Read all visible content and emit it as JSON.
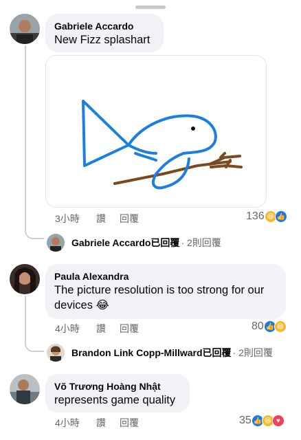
{
  "comments": [
    {
      "author": "Gabriele Accardo",
      "text": "New Fizz splashart",
      "time": "3小時",
      "like_label": "讚",
      "reply_label": "回覆",
      "reaction_count": "136",
      "reactions": [
        "haha",
        "like"
      ],
      "reply_summary": {
        "author": "Gabriele Accardo",
        "verb": "已回覆",
        "count": "· 2則回覆"
      }
    },
    {
      "author": "Paula Alexandra",
      "text": "The picture resolution is too strong for our devices 😂",
      "time": "4小時",
      "like_label": "讚",
      "reply_label": "回覆",
      "reaction_count": "80",
      "reactions": [
        "like",
        "haha"
      ],
      "reply_summary": {
        "author": "Brandon Link Copp-Millward",
        "verb": "已回覆",
        "count": "· 2則回覆"
      }
    },
    {
      "author": "Võ Trương Hoàng Nhật",
      "text": "represents game quality",
      "time": "4小時",
      "like_label": "讚",
      "reply_label": "回覆",
      "reaction_count": "35",
      "reactions": [
        "like",
        "haha",
        "love"
      ]
    }
  ],
  "colors": {
    "bubble": "#f0f2f5",
    "meta_text": "#65676b",
    "like_blue": "#1877f2",
    "fish_blue": "#1a7fe0",
    "trident_brown": "#7a4a1e"
  },
  "image": {
    "subject": "fish-drawing"
  }
}
